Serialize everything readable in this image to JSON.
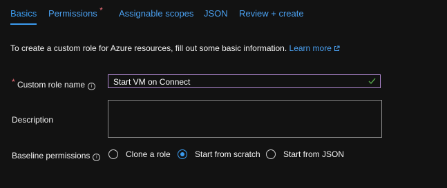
{
  "tabs": [
    {
      "label": "Basics",
      "active": true
    },
    {
      "label": "Permissions",
      "required": true
    },
    {
      "label": "Assignable scopes"
    },
    {
      "label": "JSON"
    },
    {
      "label": "Review + create"
    }
  ],
  "intro": {
    "text": "To create a custom role for Azure resources, fill out some basic information.",
    "link": "Learn more"
  },
  "form": {
    "custom_role_name": {
      "label": "Custom role name",
      "value": "Start VM on Connect",
      "valid": true
    },
    "description": {
      "label": "Description",
      "value": ""
    },
    "baseline": {
      "label": "Baseline permissions",
      "options": [
        "Clone a role",
        "Start from scratch",
        "Start from JSON"
      ],
      "selected": "Start from scratch"
    }
  },
  "colors": {
    "accent": "#3b9cf0",
    "link": "#4aa0f0",
    "required": "#f1707b",
    "valid_check": "#57a64a",
    "input_focus_border": "#b58cd6"
  }
}
